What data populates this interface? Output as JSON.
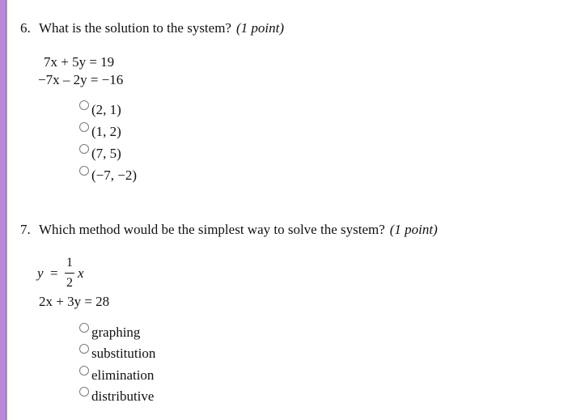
{
  "questions": [
    {
      "number": "6.",
      "prompt": "What is the solution to the system?",
      "points": "(1 point)",
      "equations": [
        "7x + 5y = 19",
        "−7x – 2y = −16"
      ],
      "options": [
        "(2, 1)",
        "(1, 2)",
        "(7, 5)",
        "(−7, −2)"
      ]
    },
    {
      "number": "7.",
      "prompt": "Which method would be the simplest way to solve the system?",
      "points": "(1 point)",
      "equation1": {
        "lhs": "y",
        "eq": "=",
        "numerator": "1",
        "denominator": "2",
        "var": "x"
      },
      "equation2": "2x + 3y = 28",
      "options": [
        "graphing",
        "substitution",
        "elimination",
        "distributive"
      ]
    }
  ]
}
